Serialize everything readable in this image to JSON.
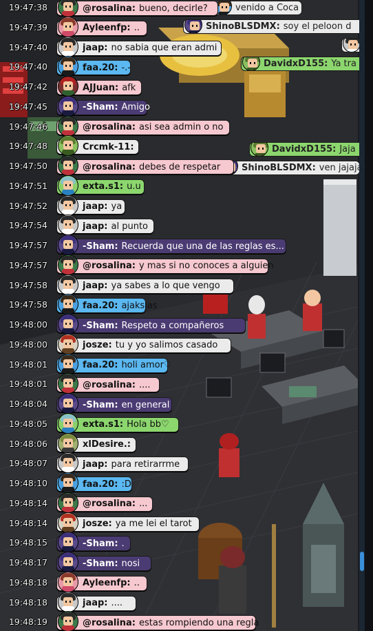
{
  "colors": {
    "pink": "#f6c8cf",
    "white": "#ebebeb",
    "blue": "#5bb8f0",
    "purple": "#4b3b73",
    "green": "#8cd66e",
    "olive": "#c4d8a0",
    "darkgreen": "#88c070"
  },
  "background_chat": [
    {
      "nick": "",
      "text": "venido a Coca",
      "color": "white",
      "avatar": "faa20"
    },
    {
      "nick": "ShinoBLSDMX:",
      "text": "soy el peloon d",
      "color": "white",
      "avatar": "sham"
    },
    {
      "nick": "",
      "text": "Dx",
      "color": "white",
      "avatar": "jaap"
    },
    {
      "nick": "DavidxD155:",
      "text": "Ya tra",
      "color": "green",
      "avatar": "crcmk"
    },
    {
      "nick": "DavidxD155:",
      "text": "Jaja",
      "color": "green",
      "avatar": "crcmk"
    },
    {
      "nick": "ShinoBLSDMX:",
      "text": "ven jajaja",
      "color": "white",
      "avatar": "sham"
    }
  ],
  "messages": [
    {
      "time": "19:47:38",
      "nick": "@rosalina:",
      "text": "bueno, decirle?",
      "color": "pink",
      "avatar": "rosalina"
    },
    {
      "time": "19:47:39",
      "nick": "Ayleenfp:",
      "text": "..",
      "color": "pink",
      "avatar": "ayleen"
    },
    {
      "time": "19:47:40",
      "nick": "jaap:",
      "text": "no sabia que eran admi",
      "color": "white",
      "avatar": "jaap"
    },
    {
      "time": "19:47:40",
      "nick": "faa.20:",
      "text": "-.-",
      "color": "blue",
      "avatar": "faa20"
    },
    {
      "time": "19:47:42",
      "nick": "AJJuan:",
      "text": "afk",
      "color": "pink",
      "avatar": "ajjuan"
    },
    {
      "time": "19:47:45",
      "nick": "-Sham:",
      "text": "Amigo",
      "color": "purple",
      "avatar": "sham"
    },
    {
      "time": "19:47:46",
      "nick": "@rosalina:",
      "text": "asi sea admin o no",
      "color": "pink",
      "avatar": "rosalina"
    },
    {
      "time": "19:47:48",
      "nick": "Crcmk-11:",
      "text": "",
      "color": "white",
      "avatar": "crcmk"
    },
    {
      "time": "19:47:50",
      "nick": "@rosalina:",
      "text": "debes de respetar",
      "color": "pink",
      "avatar": "rosalina"
    },
    {
      "time": "19:47:51",
      "nick": "exta.s1:",
      "text": "u.u",
      "color": "green",
      "avatar": "exta"
    },
    {
      "time": "19:47:52",
      "nick": "jaap:",
      "text": "ya",
      "color": "white",
      "avatar": "jaap"
    },
    {
      "time": "19:47:54",
      "nick": "jaap:",
      "text": "al punto",
      "color": "white",
      "avatar": "jaap"
    },
    {
      "time": "19:47:57",
      "nick": "-Sham:",
      "text": "Recuerda que una de las reglas es...",
      "color": "purple",
      "avatar": "sham"
    },
    {
      "time": "19:47:57",
      "nick": "@rosalina:",
      "text": "y mas si no conoces a alguien",
      "color": "pink",
      "avatar": "rosalina"
    },
    {
      "time": "19:47:58",
      "nick": "jaap:",
      "text": "ya sabes a lo que vengo",
      "color": "white",
      "avatar": "jaap"
    },
    {
      "time": "19:47:58",
      "nick": "faa.20:",
      "text": "ajaksjas",
      "color": "blue",
      "avatar": "faa20"
    },
    {
      "time": "19:48:00",
      "nick": "-Sham:",
      "text": "Respeto a compañeros",
      "color": "purple",
      "avatar": "sham"
    },
    {
      "time": "19:48:00",
      "nick": "josze:",
      "text": "tu y yo salimos casado",
      "color": "white",
      "avatar": "josze"
    },
    {
      "time": "19:48:01",
      "nick": "faa.20:",
      "text": "holi amor♡",
      "color": "blue",
      "avatar": "faa20"
    },
    {
      "time": "19:48:01",
      "nick": "@rosalina:",
      "text": "....",
      "color": "pink",
      "avatar": "rosalina"
    },
    {
      "time": "19:48:04",
      "nick": "-Sham:",
      "text": "en general",
      "color": "purple",
      "avatar": "sham"
    },
    {
      "time": "19:48:05",
      "nick": "exta.s1:",
      "text": "Hola bb♡",
      "color": "green",
      "avatar": "exta"
    },
    {
      "time": "19:48:06",
      "nick": "xlDesire.:",
      "text": "",
      "color": "white",
      "avatar": "xldesire"
    },
    {
      "time": "19:48:07",
      "nick": "jaap:",
      "text": "para retirarrme",
      "color": "white",
      "avatar": "jaap"
    },
    {
      "time": "19:48:10",
      "nick": "faa.20:",
      "text": ":D",
      "color": "blue",
      "avatar": "faa20"
    },
    {
      "time": "19:48:14",
      "nick": "@rosalina:",
      "text": "...",
      "color": "pink",
      "avatar": "rosalina"
    },
    {
      "time": "19:48:14",
      "nick": "josze:",
      "text": "ya me lei el tarot",
      "color": "white",
      "avatar": "josze"
    },
    {
      "time": "19:48:15",
      "nick": "-Sham:",
      "text": ".",
      "color": "purple",
      "avatar": "sham"
    },
    {
      "time": "19:48:17",
      "nick": "-Sham:",
      "text": "nosi",
      "color": "purple",
      "avatar": "sham"
    },
    {
      "time": "19:48:18",
      "nick": "Ayleenfp:",
      "text": "..",
      "color": "pink",
      "avatar": "ayleen"
    },
    {
      "time": "19:48:18",
      "nick": "jaap:",
      "text": "....",
      "color": "white",
      "avatar": "jaap"
    },
    {
      "time": "19:48:19",
      "nick": "@rosalina:",
      "text": "estas rompiendo una regla",
      "color": "pink",
      "avatar": "rosalina"
    }
  ],
  "avatars": {
    "rosalina": {
      "hair": "#2a2a2a",
      "body": "#c0303a",
      "bg": "#3c7a4a"
    },
    "ayleen": {
      "hair": "#8a3a2a",
      "body": "#d04a6a",
      "bg": "#e89aa8"
    },
    "jaap": {
      "hair": "#2a2a2a",
      "body": "#ffffff",
      "bg": "#c9c9c9"
    },
    "faa20": {
      "hair": "#3a2a1a",
      "body": "#1a1a1a",
      "bg": "#4aa0e0"
    },
    "ajjuan": {
      "hair": "#b02020",
      "body": "#306030",
      "bg": "#7a3030"
    },
    "sham": {
      "hair": "#3b2f7a",
      "body": "#1a1a40",
      "bg": "#5a4a8a"
    },
    "crcmk": {
      "hair": "#5a7a30",
      "body": "#3a5a20",
      "bg": "#8ac060"
    },
    "exta": {
      "hair": "#88c0c8",
      "body": "#2a80c0",
      "bg": "#8ad06a"
    },
    "josze": {
      "hair": "#b03020",
      "body": "#604020",
      "bg": "#d8d0c0"
    },
    "xldesire": {
      "hair": "#7a8a40",
      "body": "#3a3a3a",
      "bg": "#a0b070"
    }
  }
}
